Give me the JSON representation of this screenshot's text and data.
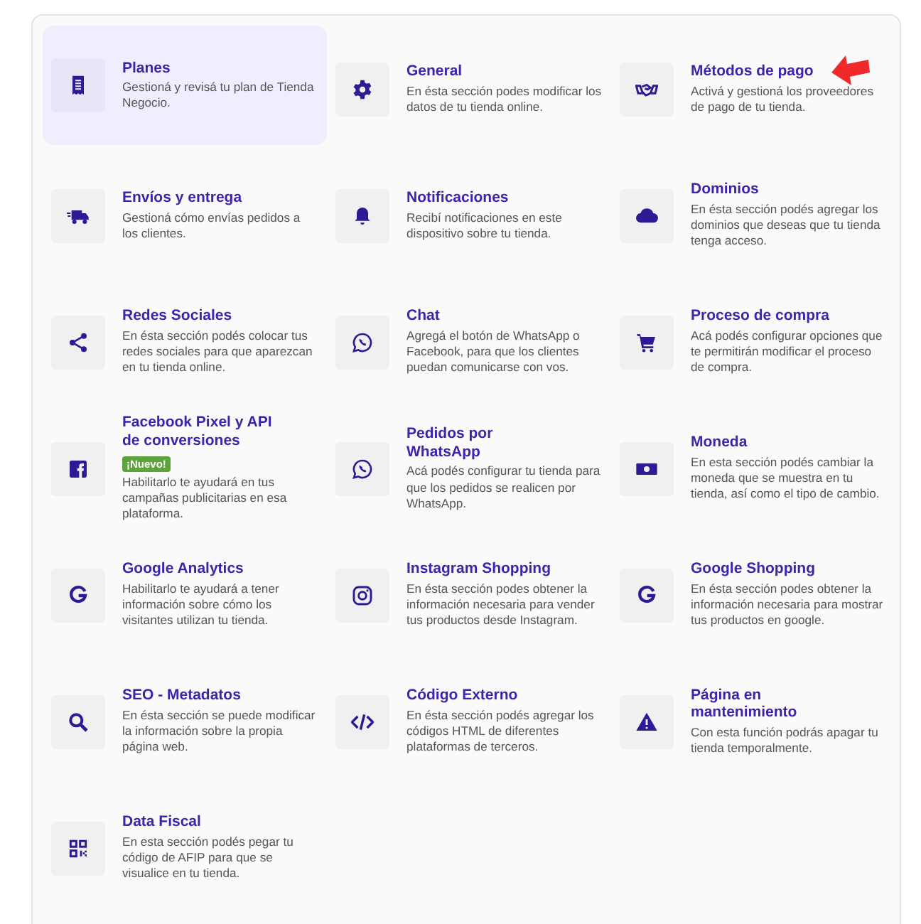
{
  "sections": [
    {
      "title": "Planes",
      "description": "Gestioná y revisá tu plan de Tienda Negocio.",
      "selected": true
    },
    {
      "title": "General",
      "description": "En ésta sección podes modificar los datos de tu tienda online.",
      "selected": false
    },
    {
      "title": "Métodos de pago",
      "description": "Activá y gestioná los proveedores de pago de tu tienda.",
      "selected": false
    },
    {
      "title": "Envíos y entrega",
      "description": "Gestioná cómo envías pedidos a los clientes.",
      "selected": false
    },
    {
      "title": "Notificaciones",
      "description": "Recibí notificaciones en este dispositivo sobre tu tienda.",
      "selected": false
    },
    {
      "title": "Dominios",
      "description": "En ésta sección podés agregar los dominios que deseas que tu tienda tenga acceso.",
      "selected": false
    },
    {
      "title": "Redes Sociales",
      "description": "En ésta sección podés colocar tus redes sociales para que aparezcan en tu tienda online.",
      "selected": false
    },
    {
      "title": "Chat",
      "description": "Agregá el botón de WhatsApp o Facebook, para que los clientes puedan comunicarse con vos.",
      "selected": false
    },
    {
      "title": "Proceso de compra",
      "description": "Acá podés configurar opciones que te permitirán modificar el proceso de compra.",
      "selected": false
    },
    {
      "title": "Facebook Pixel y API de conversiones",
      "badge": "¡Nuevo!",
      "description": "Habilitarlo te ayudará en tus campañas publicitarias en esa plataforma.",
      "selected": false
    },
    {
      "title": "Pedidos por WhatsApp",
      "description": "Acá podés configurar tu tienda para que los pedidos se realicen por WhatsApp.",
      "selected": false
    },
    {
      "title": "Moneda",
      "description": "En esta sección podés cambiar la moneda que se muestra en tu tienda, así como el tipo de cambio.",
      "selected": false
    },
    {
      "title": "Google Analytics",
      "description": "Habilitarlo te ayudará a tener información sobre cómo los visitantes utilizan tu tienda.",
      "selected": false
    },
    {
      "title": "Instagram Shopping",
      "description": "En ésta sección podes obtener la información necesaria para vender tus productos desde Instagram.",
      "selected": false
    },
    {
      "title": "Google Shopping",
      "description": "En ésta sección podes obtener la información necesaria para mostrar tus productos en google.",
      "selected": false
    },
    {
      "title": "SEO - Metadatos",
      "description": "En ésta sección se puede modificar la información sobre la propia página web.",
      "selected": false
    },
    {
      "title": "Código Externo",
      "description": "En ésta sección podés agregar los códigos HTML de diferentes plataformas de terceros.",
      "selected": false
    },
    {
      "title": "Página en mantenimiento",
      "description": "Con esta función podrás apagar tu tienda temporalmente.",
      "selected": false
    },
    {
      "title": "Data Fiscal",
      "description": "En esta sección podés pegar tu código de AFIP para que se visualice en tu tienda.",
      "selected": false
    }
  ]
}
